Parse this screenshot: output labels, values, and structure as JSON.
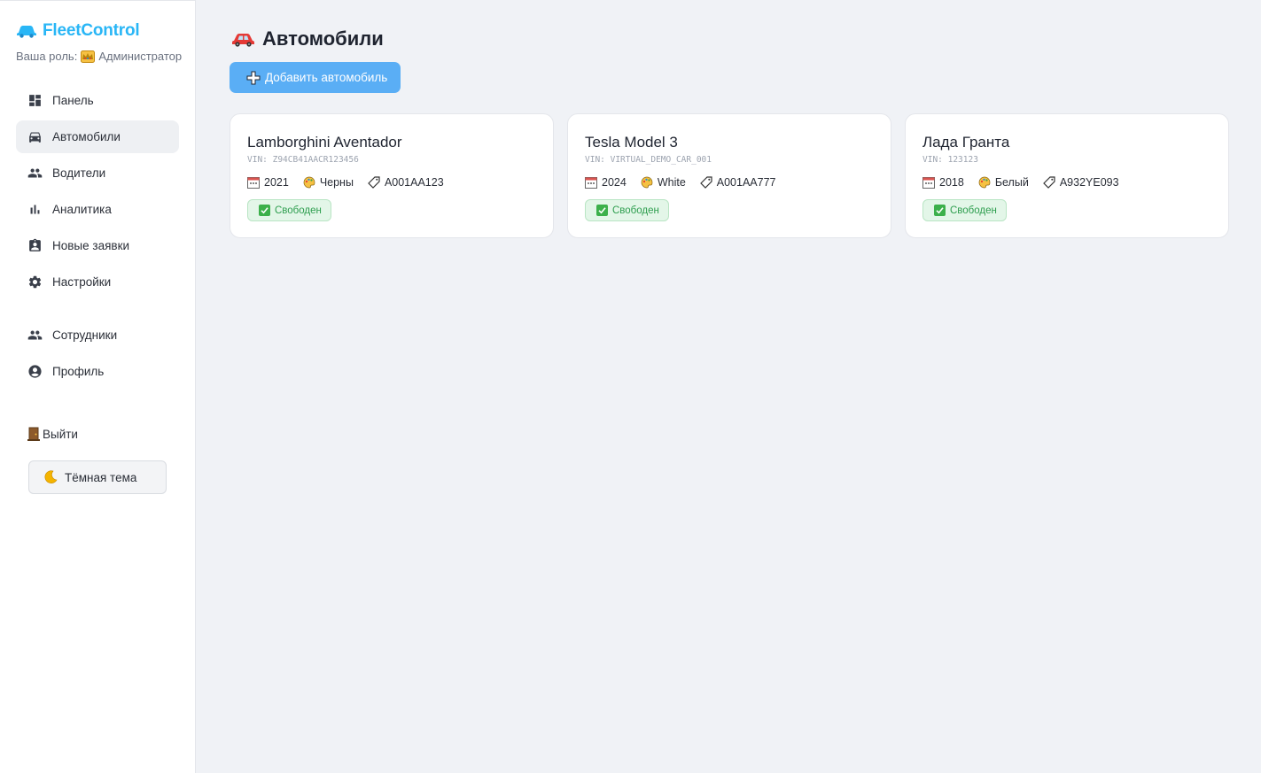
{
  "app": {
    "brand_name": "FleetControl",
    "brand_icon": "car-icon",
    "role_label": "Ваша роль:",
    "role_value": "Администратор"
  },
  "sidebar": {
    "items": [
      {
        "label": "Панель",
        "icon": "dashboard-icon",
        "active": false
      },
      {
        "label": "Автомобили",
        "icon": "car-icon",
        "active": true
      },
      {
        "label": "Водители",
        "icon": "people-icon",
        "active": false
      },
      {
        "label": "Аналитика",
        "icon": "bar-chart-icon",
        "active": false
      },
      {
        "label": "Новые заявки",
        "icon": "clipboard-icon",
        "active": false
      },
      {
        "label": "Настройки",
        "icon": "gear-icon",
        "active": false
      },
      {
        "label": "Сотрудники",
        "icon": "people-icon",
        "active": false
      },
      {
        "label": "Профиль",
        "icon": "account-icon",
        "active": false
      }
    ],
    "logout_label": "Выйти",
    "theme_label": "Тёмная тема"
  },
  "main": {
    "title": "Автомобили",
    "add_button": "Добавить автомобиль",
    "cars": [
      {
        "name": "Lamborghini Aventador",
        "vin": "VIN: Z94CB41AACR123456",
        "year": "2021",
        "color": "Черны",
        "plate": "A001AA123",
        "status": "Свободен"
      },
      {
        "name": "Tesla Model 3",
        "vin": "VIN: VIRTUAL_DEMO_CAR_001",
        "year": "2024",
        "color": "White",
        "plate": "A001AA777",
        "status": "Свободен"
      },
      {
        "name": "Лада Гранта",
        "vin": "VIN: 123123",
        "year": "2018",
        "color": "Белый",
        "plate": "A932YE093",
        "status": "Свободен"
      }
    ]
  },
  "colors": {
    "brand": "#29b6f6",
    "primary_button": "#5aaef5",
    "status_ok": "#2e9e4f",
    "background": "#f0f2f6"
  }
}
